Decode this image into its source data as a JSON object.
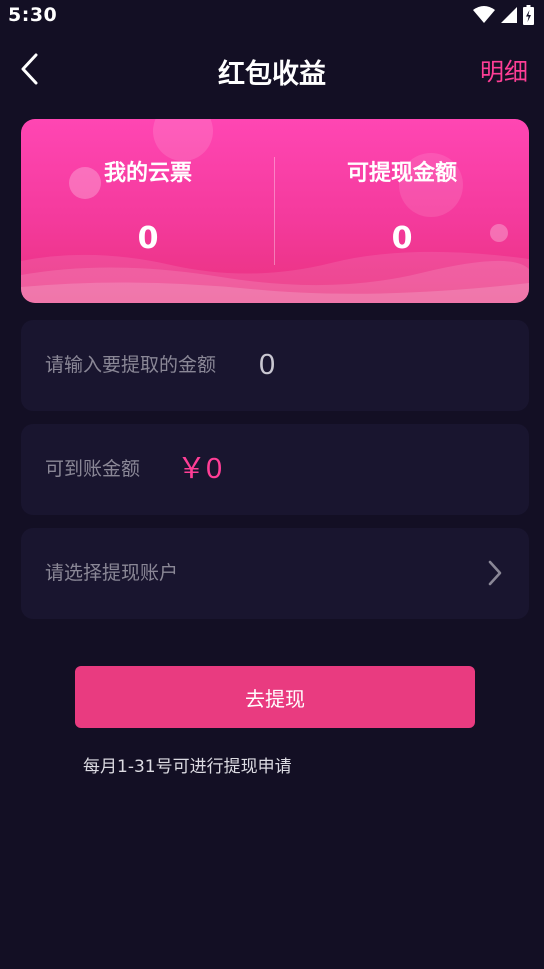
{
  "status_bar": {
    "time": "5:30",
    "icons": [
      "wifi-icon",
      "cell-signal-icon",
      "battery-charging-icon"
    ]
  },
  "header": {
    "title": "红包收益",
    "back_icon": "chevron-left-icon",
    "detail_label": "明细"
  },
  "balance_card": {
    "left": {
      "label": "我的云票",
      "value": "0"
    },
    "right": {
      "label": "可提现金额",
      "value": "0"
    }
  },
  "withdraw_form": {
    "amount": {
      "label": "请输入要提取的金额",
      "placeholder": "0",
      "value": ""
    },
    "arrive": {
      "label": "可到账金额",
      "value": "￥0"
    },
    "account": {
      "label": "请选择提现账户",
      "icon": "chevron-right-icon"
    }
  },
  "submit": {
    "label": "去提现"
  },
  "note": "每月1-31号可进行提现申请",
  "colors": {
    "background": "#130f24",
    "panel": "#19152f",
    "accent": "#ff3e96",
    "button": "#e93b80",
    "card_top": "#ff46b3",
    "card_bottom": "#e9327f"
  }
}
